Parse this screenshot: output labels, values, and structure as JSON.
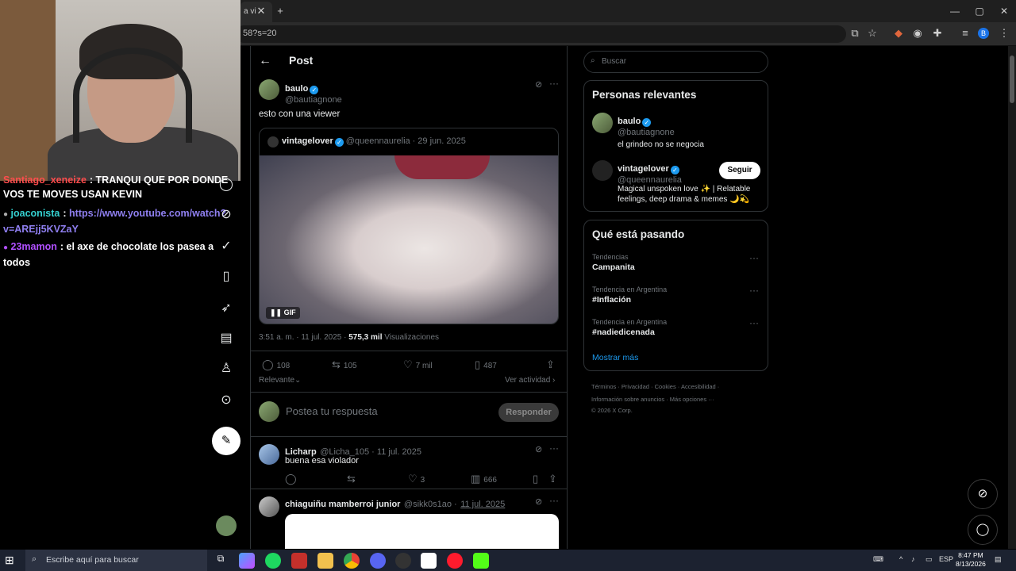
{
  "browser": {
    "tab_title": "a vi",
    "url_text": "58?s=20",
    "controls": [
      "—",
      "▢",
      "✕"
    ]
  },
  "chat": {
    "lines": [
      {
        "user": "Santiago_xeneize",
        "user_color": "#ff4d4d",
        "message": ": TRANQUI QUE POR DONDE VOS TE MOVES USAN KEVIN"
      },
      {
        "user": "joaconista",
        "user_color": "#35d0d0",
        "message": ":",
        "link": "https://www.youtube.com/watch?v=AREjj5KVZaY"
      },
      {
        "user": "23mamon",
        "user_color": "#b050ff",
        "message": ": el axe de chocolate los pasea a todos"
      }
    ]
  },
  "main": {
    "title": "Post",
    "author": {
      "name": "baulo",
      "handle": "@bautiagnone"
    },
    "text": "esto con una viewer",
    "quote": {
      "name": "vintagelover",
      "handle": "@queennaurelia",
      "date": "· 29 jun. 2025",
      "media_badge": "GIF"
    },
    "timestamp": "3:51 a. m. · 11 jul. 2025 · ",
    "views_count": "575,3 mil",
    "views_label": "Visualizaciones",
    "stats": {
      "replies": "108",
      "reposts": "105",
      "likes": "7 mil",
      "bookmarks": "487"
    },
    "sort_label": "Relevante",
    "activity_label": "Ver actividad",
    "reply_placeholder": "Postea tu respuesta",
    "reply_button": "Responder",
    "replies": [
      {
        "name": "Licharp",
        "handle": "@Licha_105 · 11 jul. 2025",
        "text": "buena esa violador",
        "likes": "3",
        "views": "666"
      },
      {
        "name": "chiaguiñu mamberroi junior",
        "handle": "@sikk0s1ao ·",
        "date": "11 jul. 2025"
      }
    ]
  },
  "right": {
    "search_placeholder": "Buscar",
    "relevant_title": "Personas relevantes",
    "people": [
      {
        "name": "baulo",
        "handle": "@bautiagnone",
        "bio": "el grindeo no se negocia"
      },
      {
        "name": "vintagelover",
        "handle": "@queennaurelia",
        "bio": "Magical unspoken love ✨ | Relatable feelings, deep drama & memes 🌙💫",
        "follow": "Seguir"
      }
    ],
    "trending_title": "Qué está pasando",
    "trends": [
      {
        "category": "Tendencias",
        "name": "Campanita"
      },
      {
        "category": "Tendencia en Argentina",
        "name": "#Inflación"
      },
      {
        "category": "Tendencia en Argentina",
        "name": "#nadiedicenada"
      }
    ],
    "show_more": "Mostrar más",
    "footer_line1": "Términos · Privacidad · Cookies · Accesibilidad ·",
    "footer_line2": "Información sobre anuncios · Más opciones ···",
    "footer_line3": "© 2026 X Corp."
  },
  "taskbar": {
    "search_placeholder": "Escribe aquí para buscar",
    "lang": "ESP",
    "time": "8:47 PM",
    "date": "8/13/2026"
  }
}
